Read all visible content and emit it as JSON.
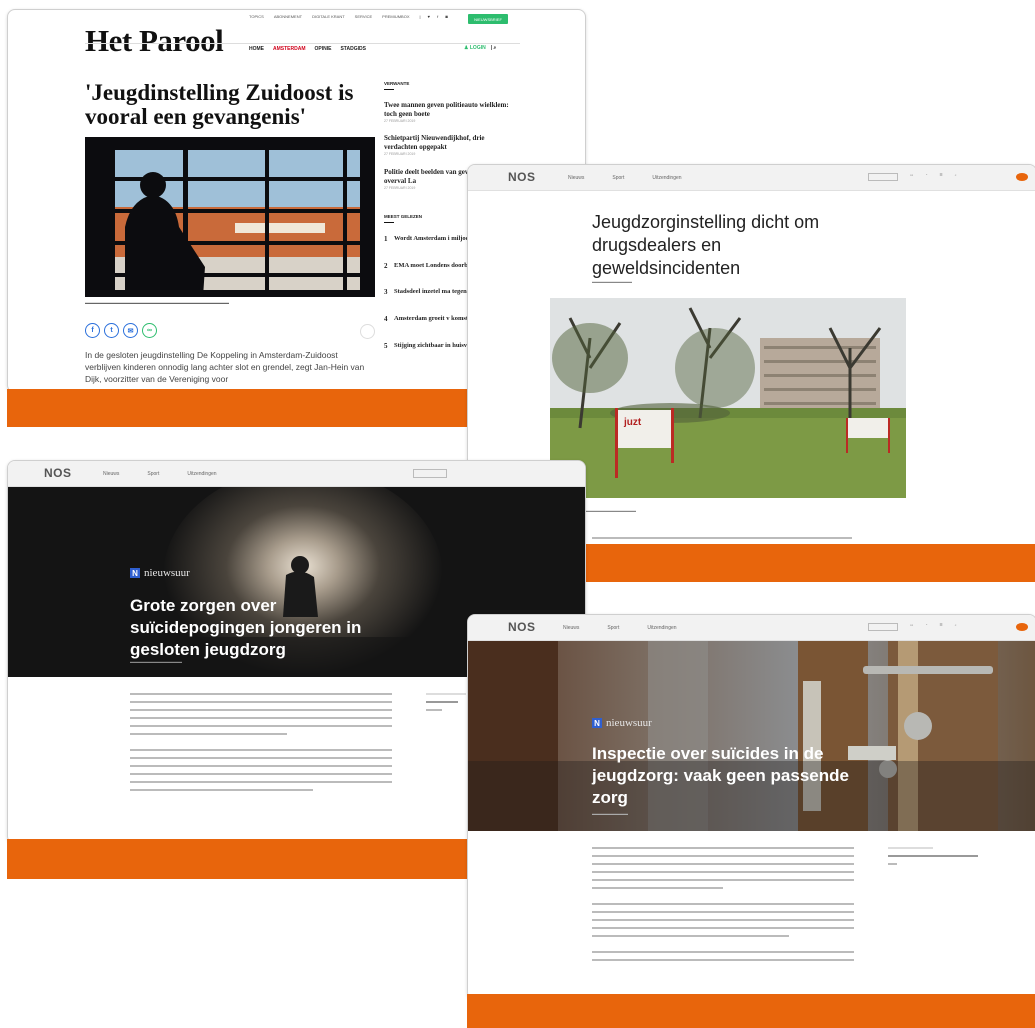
{
  "parool": {
    "logo": "Het Parool",
    "top_links": [
      "TOPICS",
      "ABONNEMENT",
      "DIGITALE KRANT",
      "SERVICE",
      "PREMIUMBOX"
    ],
    "cta": "NIEUWSBRIEF",
    "nav": [
      "HOME",
      "AMSTERDAM",
      "OPINIE",
      "STADGIDS"
    ],
    "login": "LOGIN",
    "headline": "'Jeugdinstelling Zuidoost is vooral een gevangenis'",
    "body": "In de gesloten jeugdinstelling De Koppeling in Amsterdam-Zuidoost verblijven kinderen onnodig lang achter slot en grendel, zegt Jan-Hein van Dijk, voorzitter van de Vereniging voor",
    "sidebar": {
      "section1": "VERWANTE",
      "items": [
        {
          "title": "Twee mannen geven politieauto wielklem: toch geen boete",
          "date": "27 FEBRUARI 2019"
        },
        {
          "title": "Schietpartij Nieuwendijkhof, drie verdachten opgepakt",
          "date": "27 FEBRUARI 2019"
        },
        {
          "title": "Politie deelt beelden van gewelddadige overval La",
          "date": "27 FEBRUARI 2019"
        }
      ],
      "section2": "MEEST GELEZEN",
      "ranked": [
        {
          "num": "1",
          "title": "Wordt Amsterdam i miljoenenstad?"
        },
        {
          "num": "2",
          "title": "EMA moet Londens doorbetalen"
        },
        {
          "num": "3",
          "title": "Stadsdeel inzetel ma tegen festivals in We"
        },
        {
          "num": "4",
          "title": "Amsterdam groeit v komst van expats"
        },
        {
          "num": "5",
          "title": "Stijging zichtbaar in huisvesting statushe"
        }
      ]
    }
  },
  "nos_top": {
    "logo": "NOS",
    "nav": [
      "Nieuws",
      "Sport",
      "Uitzendingen"
    ],
    "title": "Jeugdzorginstelling dicht om drugsdealers en geweldsincidenten",
    "sign": "juzt"
  },
  "nos_left": {
    "logo": "NOS",
    "nav": [
      "Nieuws",
      "Sport",
      "Uitzendingen"
    ],
    "brand": "nieuwsuur",
    "title": "Grote zorgen over suïcidepogingen jongeren in gesloten jeugdzorg"
  },
  "nos_bottom": {
    "logo": "NOS",
    "nav": [
      "Nieuws",
      "Sport",
      "Uitzendingen"
    ],
    "brand": "nieuwsuur",
    "title": "Inspectie over suïcides in de jeugdzorg: vaak geen passende zorg"
  },
  "colors": {
    "accent": "#e8650c",
    "parool_red": "#d0021b",
    "parool_green": "#2dbd6e"
  }
}
